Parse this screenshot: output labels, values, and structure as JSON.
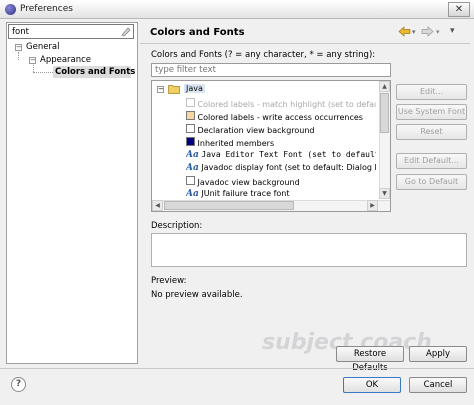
{
  "window": {
    "title": "Preferences",
    "close_symbol": "✕"
  },
  "filter": {
    "value": "font"
  },
  "tree": {
    "items": [
      {
        "label": "General"
      },
      {
        "label": "Appearance"
      },
      {
        "label": "Colors and Fonts"
      }
    ]
  },
  "page": {
    "title": "Colors and Fonts",
    "description": "Colors and Fonts (? = any character, * = any string):",
    "filter_placeholder": "type filter text"
  },
  "list": {
    "group_label": "Java",
    "rows": [
      {
        "label": "Colored labels - match highlight (set to default: Mat",
        "kind": "color",
        "color": "#ffffff",
        "dimmed": true
      },
      {
        "label": "Colored labels - write access occurrences",
        "kind": "color",
        "color": "#f5d7a0",
        "dimmed": false
      },
      {
        "label": "Declaration view background",
        "kind": "color",
        "color": "#ffffff",
        "dimmed": false
      },
      {
        "label": "Inherited members",
        "kind": "color",
        "color": "#000080",
        "dimmed": false
      },
      {
        "label": "Java Editor Text Font (set to default: Text Font)",
        "kind": "font",
        "mono": true
      },
      {
        "label": "Javadoc display font (set to default: Dialog Font)",
        "kind": "font",
        "mono": false
      },
      {
        "label": "Javadoc view background",
        "kind": "color",
        "color": "#ffffff",
        "dimmed": false
      },
      {
        "label": "JUnit failure trace font",
        "kind": "font",
        "mono": false
      }
    ]
  },
  "side_buttons": [
    "Edit...",
    "Use System Font",
    "Reset",
    "Edit Default...",
    "Go to Default"
  ],
  "labels": {
    "description": "Description:",
    "preview": "Preview:",
    "no_preview": "No preview available."
  },
  "buttons": {
    "restore_defaults": "Restore Defaults",
    "apply": "Apply",
    "ok": "OK",
    "cancel": "Cancel"
  },
  "watermark": "subject coach",
  "icons": {
    "back": "back-arrow-icon",
    "forward": "forward-arrow-icon",
    "menu": "view-menu-icon",
    "help": "help-icon"
  }
}
